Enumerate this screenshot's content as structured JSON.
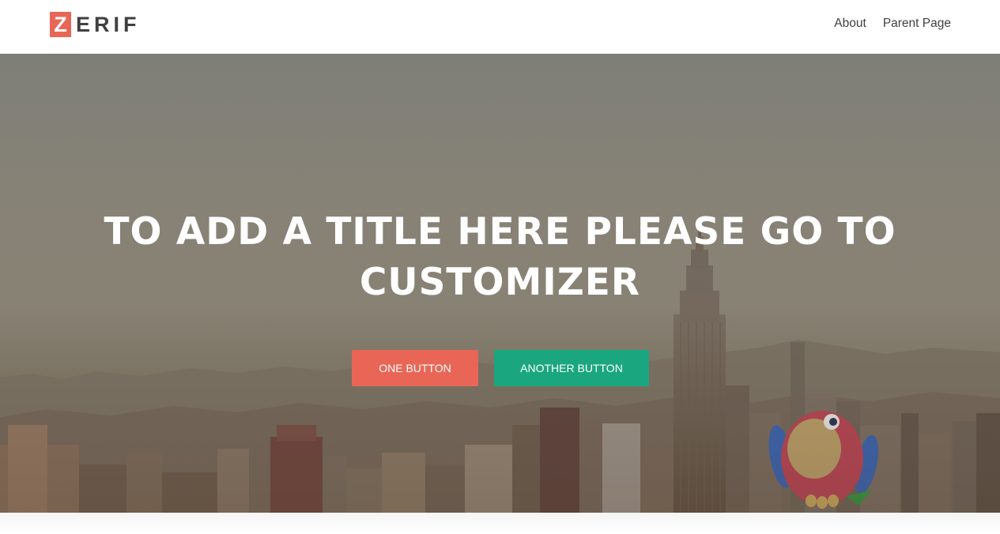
{
  "header": {
    "logo_first_letter": "Z",
    "logo_rest": "ERIF",
    "nav": [
      {
        "label": "About"
      },
      {
        "label": "Parent Page"
      }
    ]
  },
  "hero": {
    "title_line1": "TO ADD A TITLE HERE PLEASE GO TO",
    "title_line2": "CUSTOMIZER",
    "buttons": {
      "one": "ONE BUTTON",
      "two": "ANOTHER BUTTON"
    },
    "background_image": "city-skyline-empire-state-building",
    "mascot": "parrot-mascot"
  },
  "colors": {
    "accent_red": "#e96656",
    "accent_green": "#1aa67f",
    "text_dark": "#404040"
  }
}
